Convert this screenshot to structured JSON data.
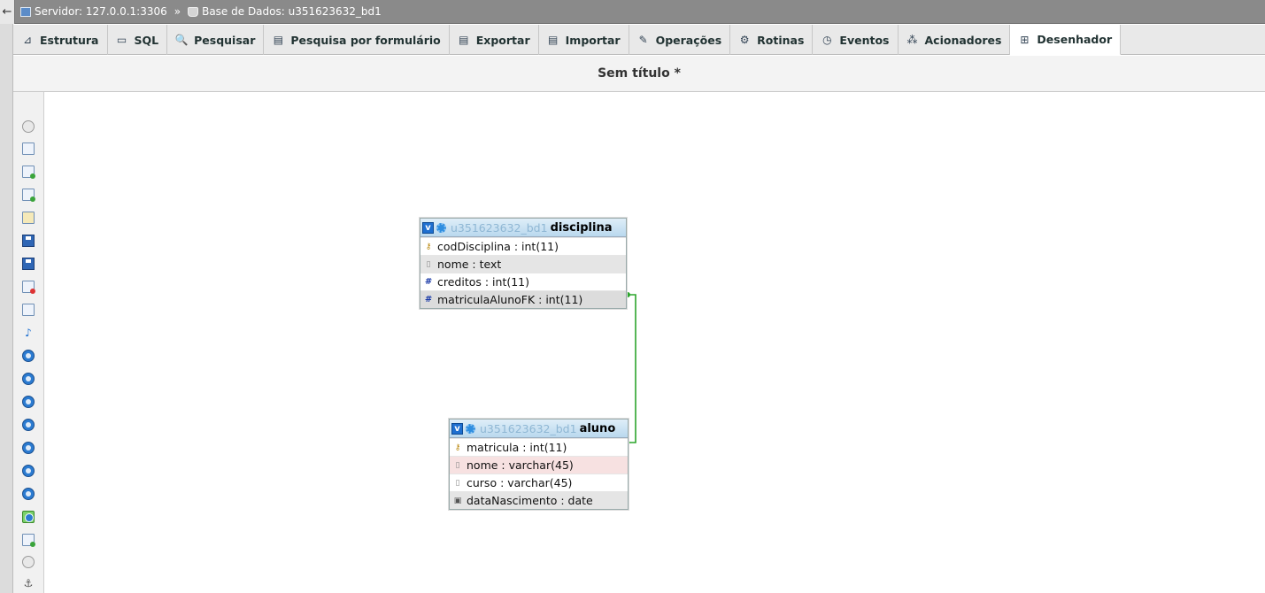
{
  "breadcrumb": {
    "back_glyph": "←",
    "server": "Servidor: 127.0.0.1:3306",
    "separator": "»",
    "database": "Base de Dados: u351623632_bd1"
  },
  "tabs": [
    {
      "label": "Estrutura",
      "icon": "structure-icon",
      "glyph": "⊿"
    },
    {
      "label": "SQL",
      "icon": "sql-icon",
      "glyph": "▭"
    },
    {
      "label": "Pesquisar",
      "icon": "search-icon",
      "glyph": "🔍"
    },
    {
      "label": "Pesquisa por formulário",
      "icon": "query-form-icon",
      "glyph": "▤"
    },
    {
      "label": "Exportar",
      "icon": "export-icon",
      "glyph": "▤"
    },
    {
      "label": "Importar",
      "icon": "import-icon",
      "glyph": "▤"
    },
    {
      "label": "Operações",
      "icon": "wrench-icon",
      "glyph": "✎"
    },
    {
      "label": "Rotinas",
      "icon": "routines-icon",
      "glyph": "⚙"
    },
    {
      "label": "Eventos",
      "icon": "clock-icon",
      "glyph": "◷"
    },
    {
      "label": "Acionadores",
      "icon": "triggers-icon",
      "glyph": "⁂"
    },
    {
      "label": "Desenhador",
      "icon": "designer-icon",
      "glyph": "⊞"
    }
  ],
  "active_tab": "Desenhador",
  "page_title": "Sem título *",
  "tables": {
    "disciplina": {
      "db": "u351623632_bd1",
      "name": "disciplina",
      "columns": [
        {
          "label": "codDisciplina : int(11)",
          "kind": "key"
        },
        {
          "label": "nome : text",
          "kind": "txt"
        },
        {
          "label": "creditos : int(11)",
          "kind": "num"
        },
        {
          "label": "matriculaAlunoFK : int(11)",
          "kind": "num"
        }
      ]
    },
    "aluno": {
      "db": "u351623632_bd1",
      "name": "aluno",
      "columns": [
        {
          "label": "matricula : int(11)",
          "kind": "key"
        },
        {
          "label": "nome : varchar(45)",
          "kind": "txt"
        },
        {
          "label": "curso : varchar(45)",
          "kind": "txt"
        },
        {
          "label": "dataNascimento : date",
          "kind": "dt"
        }
      ]
    }
  },
  "colors": {
    "relation_line": "#2ca52c",
    "header_gradient_top": "#dfeef8",
    "header_gradient_bottom": "#b9d8ee",
    "accent_blue": "#1e6fd0"
  }
}
